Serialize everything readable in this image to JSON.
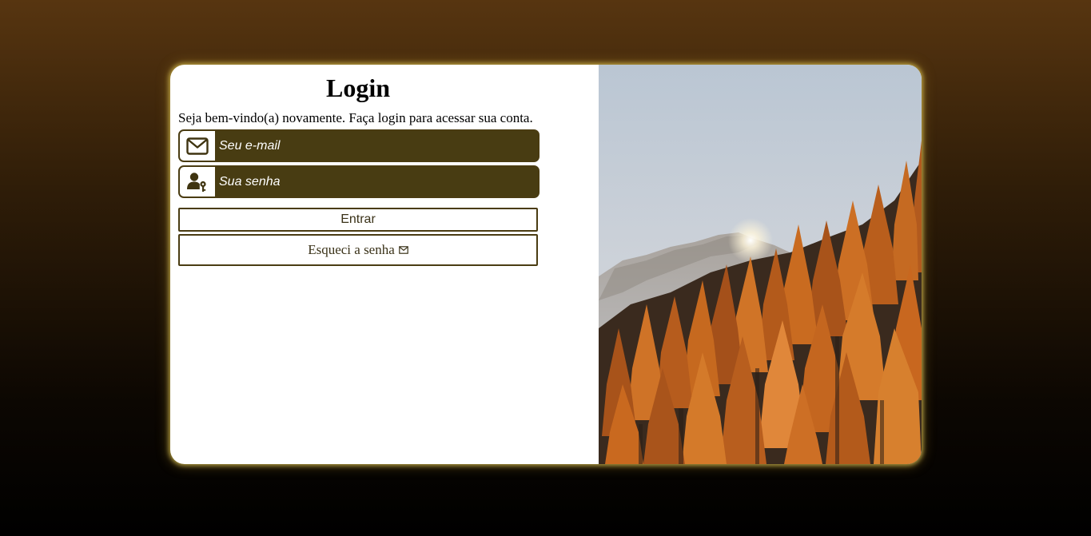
{
  "login": {
    "title": "Login",
    "subtitle": "Seja bem-vindo(a) novamente. Faça login para acessar sua conta.",
    "email_placeholder": "Seu e-mail",
    "email_icon": "envelope-icon",
    "password_placeholder": "Sua senha",
    "password_icon": "user-key-icon",
    "enter_label": "Entrar",
    "forgot_label": "Esqueci a senha",
    "forgot_icon": "small-envelope-icon"
  },
  "hero_image": {
    "subject": "autumn larch forest with snowy mountain and sun"
  },
  "colors": {
    "accent": "#483c12",
    "border": "#4a3c12",
    "card_glow": "#d6be50",
    "bg_top": "#573510",
    "bg_bottom": "#000000"
  }
}
